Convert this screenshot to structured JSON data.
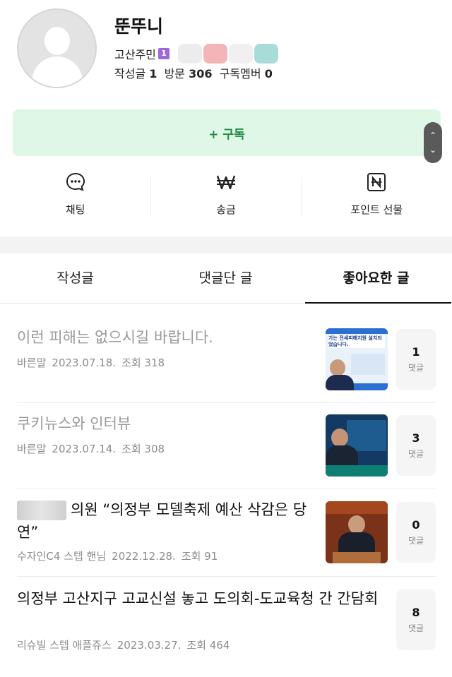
{
  "profile": {
    "nickname": "뚠뚜니",
    "grade": "고산주민",
    "grade_badge": "1",
    "stats_posts_label": "작성글",
    "stats_posts_value": "1",
    "stats_visits_label": "방문",
    "stats_visits_value": "306",
    "stats_members_label": "구독멤버",
    "stats_members_value": "0"
  },
  "subscribe": {
    "label": "+ 구독"
  },
  "actions": [
    {
      "label": "채팅",
      "icon": "chat-bubble-icon"
    },
    {
      "label": "송금",
      "icon": "won-icon"
    },
    {
      "label": "포인트 선물",
      "icon": "naver-point-icon"
    }
  ],
  "tabs": [
    {
      "label": "작성글"
    },
    {
      "label": "댓글단 글"
    },
    {
      "label": "좋아요한 글"
    }
  ],
  "posts": [
    {
      "title": "이런 피해는 없으시길 바랍니다.",
      "author": "바른말",
      "date": "2023.07.18.",
      "views": "조회 318",
      "comments": "1",
      "comment_label": "댓글"
    },
    {
      "title": "쿠키뉴스와 인터뷰",
      "author": "바른말",
      "date": "2023.07.14.",
      "views": "조회 308",
      "comments": "3",
      "comment_label": "댓글"
    },
    {
      "title": "의원 “의정부 모델축제 예산 삭감은 당연”",
      "author": "수자인C4 스텝 핸님",
      "date": "2022.12.28.",
      "views": "조회 91",
      "comments": "0",
      "comment_label": "댓글"
    },
    {
      "title": "의정부 고산지구 고교신설 놓고 도의회-도교육청 간 간담회",
      "author": "리슈빌 스텝 애플쥬스",
      "date": "2023.03.27.",
      "views": "조회 464",
      "comments": "8",
      "comment_label": "댓글"
    }
  ],
  "thumbs": {
    "t1_caption": "가는 전세피해지원 설치되었습니다."
  },
  "colors": {
    "accent_green": "#1f8d46",
    "subscribe_bg": "#dff7e7",
    "grade_badge": "#9b6ad6"
  }
}
